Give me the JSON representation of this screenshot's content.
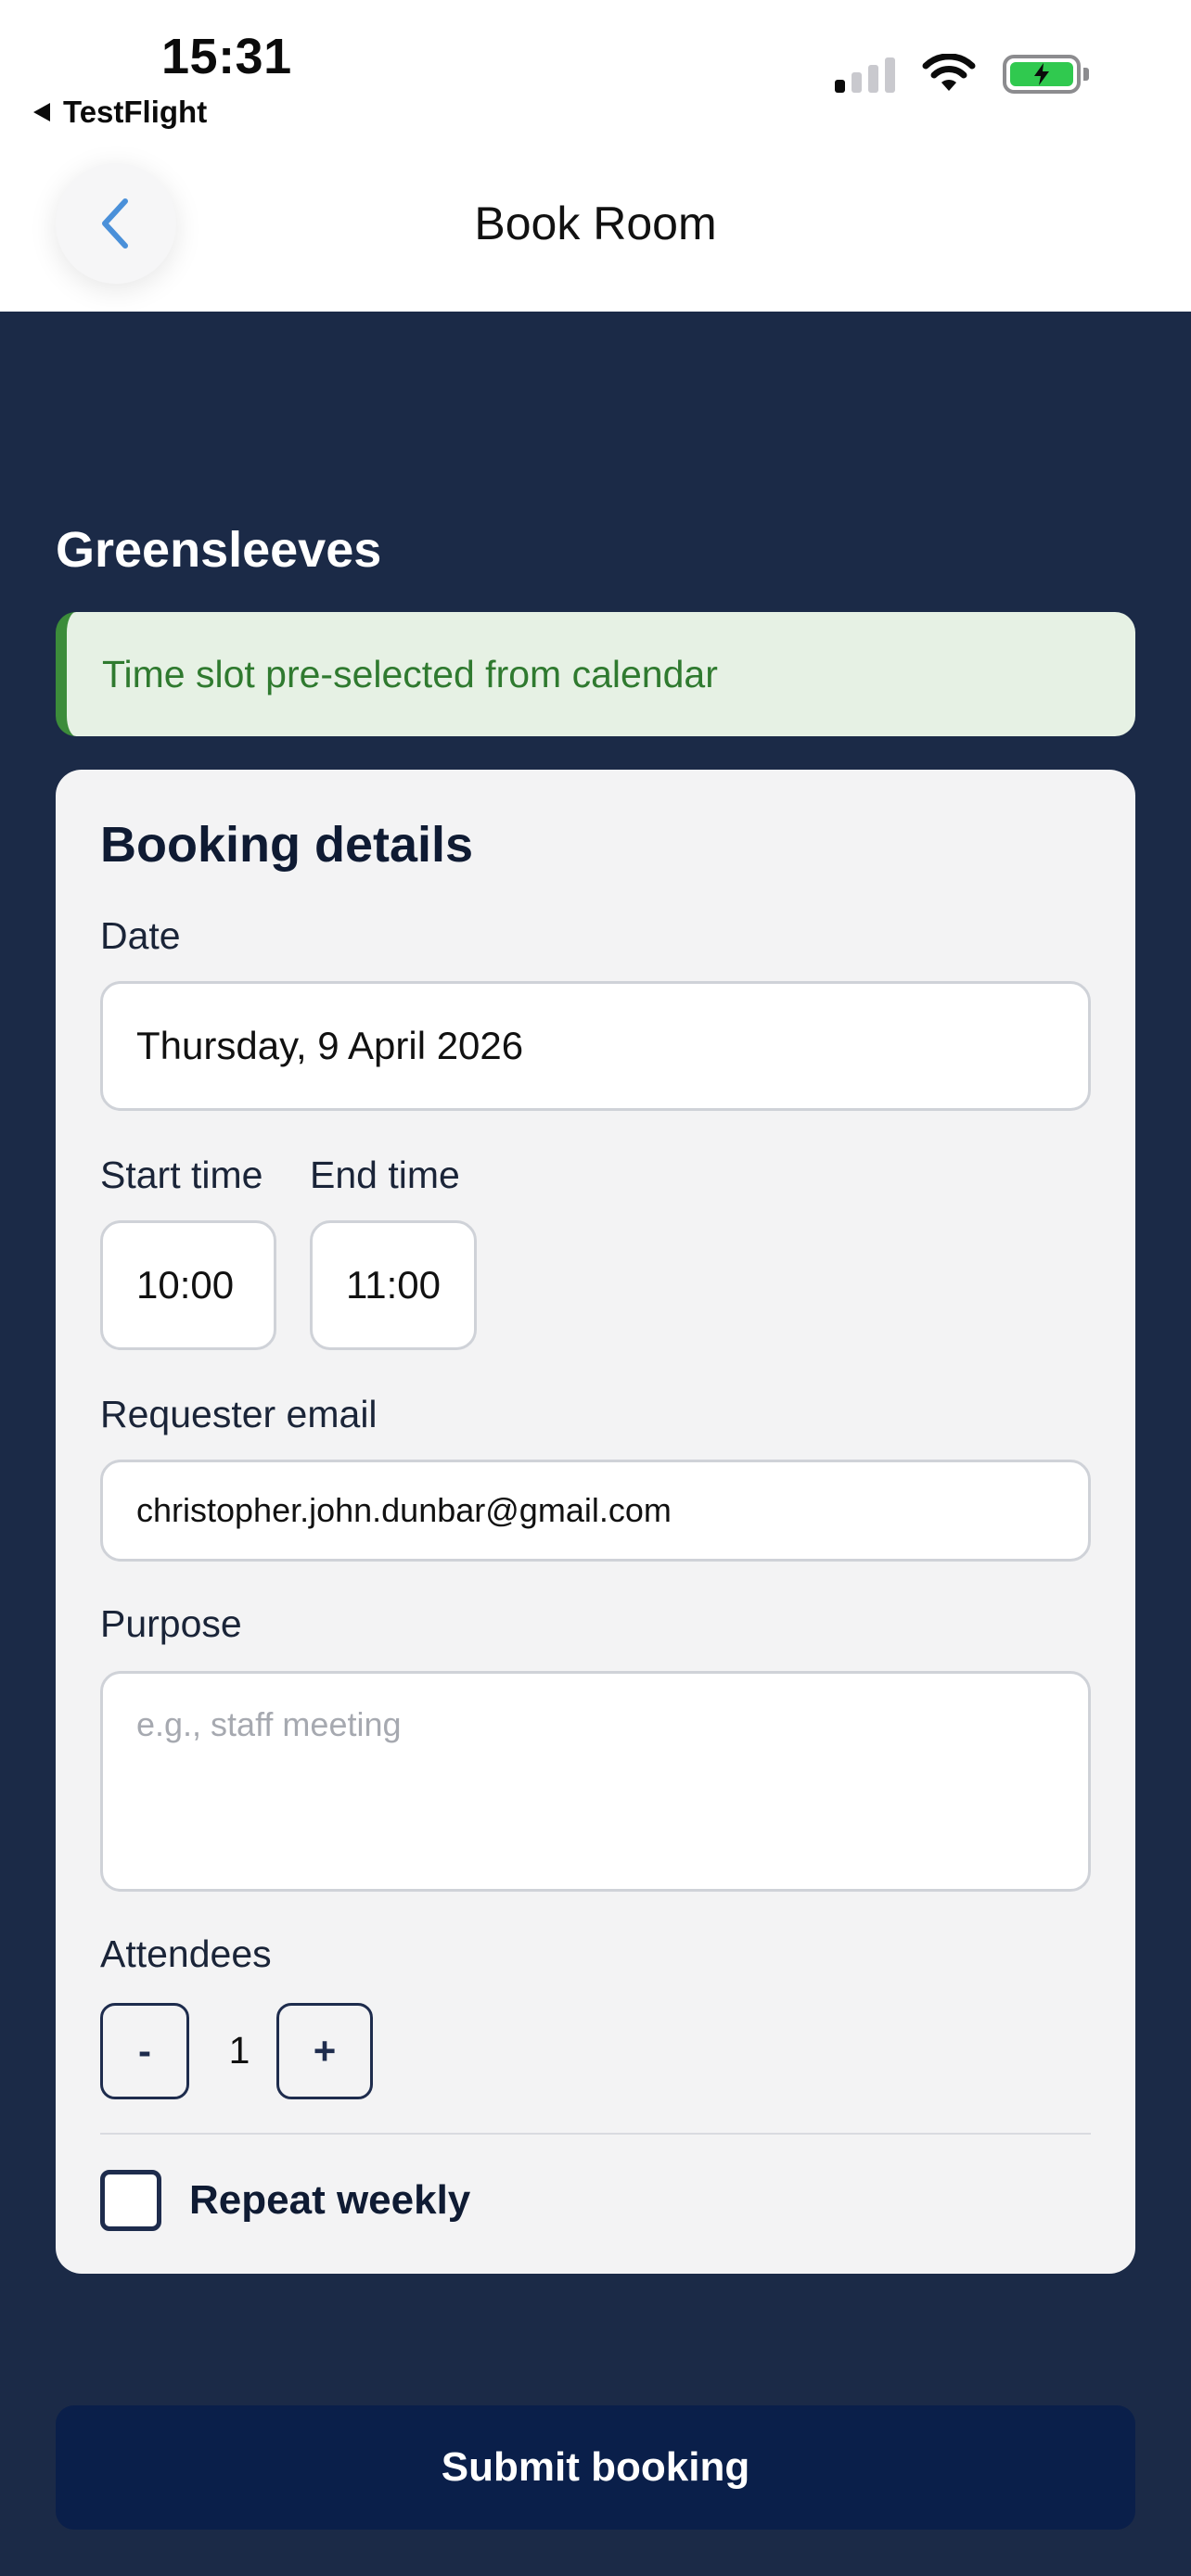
{
  "status_bar": {
    "time": "15:31",
    "back_app_label": "TestFlight"
  },
  "nav": {
    "title": "Book Room"
  },
  "room": {
    "name": "Greensleeves"
  },
  "notice": {
    "text": "Time slot pre-selected from calendar"
  },
  "form": {
    "title": "Booking details",
    "date_label": "Date",
    "date_value": "Thursday, 9 April 2026",
    "start_label": "Start time",
    "start_value": "10:00",
    "end_label": "End time",
    "end_value": "11:00",
    "email_label": "Requester email",
    "email_value": "christopher.john.dunbar@gmail.com",
    "purpose_label": "Purpose",
    "purpose_placeholder": "e.g., staff meeting",
    "attendees_label": "Attendees",
    "attendees_minus": "-",
    "attendees_value": "1",
    "attendees_plus": "+",
    "repeat_label": "Repeat weekly",
    "repeat_checked": false
  },
  "submit_label": "Submit booking",
  "colors": {
    "background": "#1b2a47",
    "card": "#f3f3f4",
    "notice_bg": "#e6f1e4",
    "notice_text": "#2f7a2f",
    "submit_bg": "#0a1f4a",
    "back_chevron": "#4a90d9"
  }
}
